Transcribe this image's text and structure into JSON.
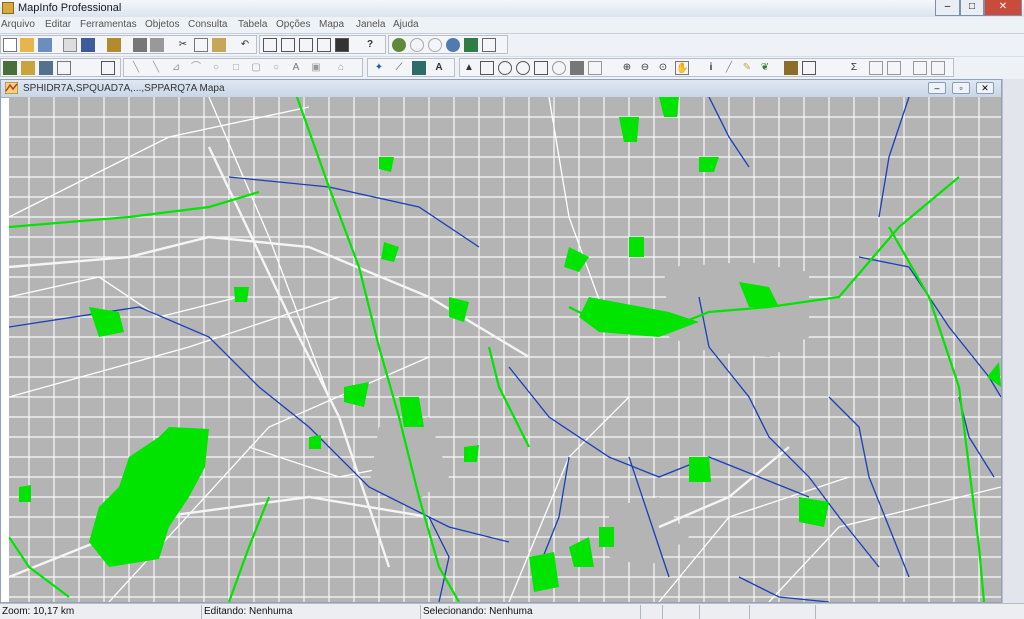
{
  "window": {
    "title": "MapInfo Professional",
    "controls": [
      "–",
      "□",
      "✕"
    ]
  },
  "menu": [
    "Arquivo",
    "Editar",
    "Ferramentas",
    "Objetos",
    "Consulta",
    "Tabela",
    "Opções",
    "Mapa",
    "Janela",
    "Ajuda"
  ],
  "toolbar1": {
    "buttons": [
      "new-doc-icon",
      "open-folder-icon",
      "open-workspace-icon",
      "close-icon",
      "save-icon",
      "save-copy-icon",
      "print-icon",
      "cut-icon",
      "copy-icon",
      "paste-icon",
      "undo-icon",
      "new-browser-icon",
      "new-mapper-icon",
      "new-grapher-icon",
      "new-layout-icon",
      "new-redistrict-icon",
      "help-pointer-icon",
      "hotlink-icon",
      "toggle-icon",
      "globe-icon",
      "layer-icon",
      "legend-icon"
    ],
    "help_label": "?"
  },
  "toolbar2": {
    "buttons": [
      "symbol-style-icon",
      "line-style-icon",
      "region-style-icon",
      "text-style-icon",
      "reshape-icon",
      "polyline-icon",
      "line-icon",
      "polygon-icon",
      "arc-icon",
      "ellipse-icon",
      "rectangle-icon",
      "rounded-rect-icon",
      "text-tool-icon",
      "frame-icon",
      "add-node-icon",
      "pointer-icon",
      "select-icon",
      "marquee-icon",
      "radius-select-icon",
      "polygon-select-icon",
      "boundary-select-icon",
      "unselect-icon",
      "invert-select-icon",
      "zoom-in-icon",
      "zoom-out-icon",
      "change-view-icon",
      "grabber-icon",
      "info-icon",
      "ruler-icon",
      "label-icon",
      "layer-control-icon",
      "legend-view-icon",
      "sum-icon",
      "graph-select-icon",
      "cosmetic-icon",
      "drag-map-icon",
      "statistics-icon"
    ],
    "text_tool_label": "A",
    "sum_label": "Σ",
    "info_label": "i"
  },
  "map_window": {
    "title": "SPHIDR7A,SPQUAD7A,...,SPPARQ7A Mapa",
    "controls": [
      "–",
      "▫",
      "✕"
    ]
  },
  "map_colors": {
    "blocks": "#b4b4b4",
    "streets": "#ffffff",
    "parks": "#00e400",
    "rivers": "#1a3fb8"
  },
  "status": {
    "zoom": "Zoom: 10,17 km",
    "editing": "Editando: Nenhuma",
    "selecting": "Selecionando: Nenhuma"
  }
}
